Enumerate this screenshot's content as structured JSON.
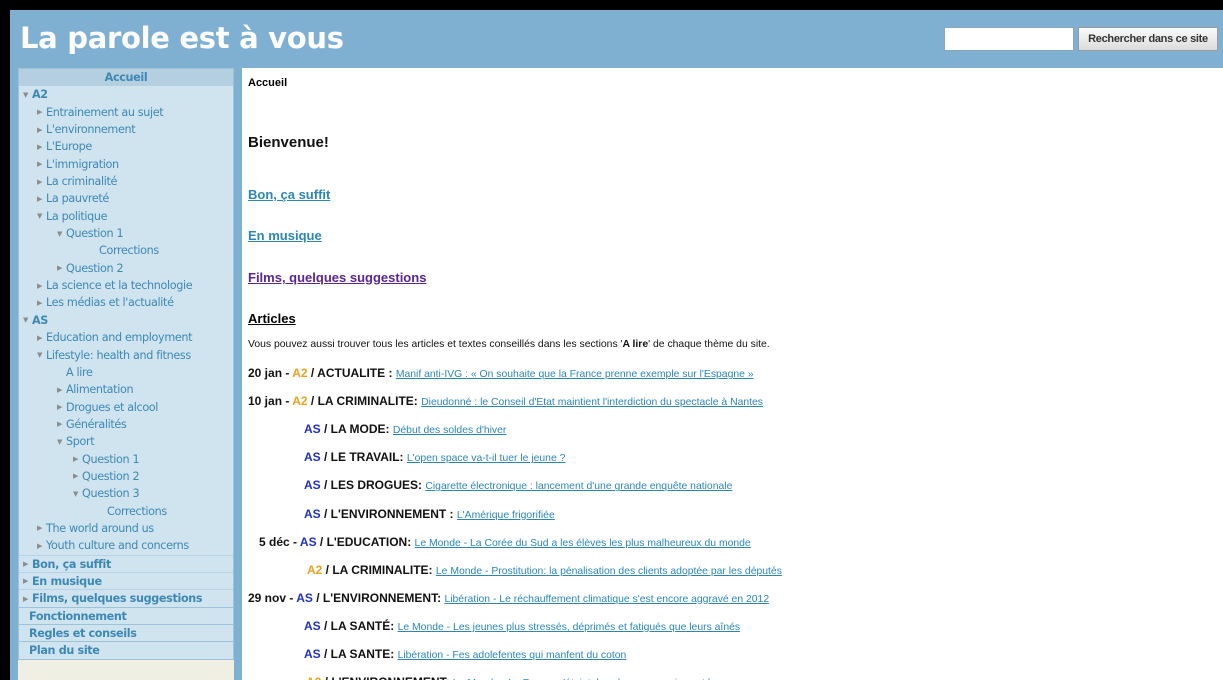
{
  "site": {
    "title": "La parole est à vous"
  },
  "search": {
    "placeholder": "",
    "value": "",
    "button_label": "Rechercher dans ce site"
  },
  "sidebar": {
    "items": [
      {
        "label": "Accueil",
        "level": 0,
        "arrow": "",
        "kind": "active",
        "name": "sidebar-item-accueil"
      },
      {
        "label": "A2",
        "level": 0,
        "arrow": "down",
        "kind": "sec",
        "name": "sidebar-item-a2"
      },
      {
        "label": "Entrainement au sujet",
        "level": 1,
        "arrow": "right",
        "kind": "item",
        "name": "sidebar-item-entrainement"
      },
      {
        "label": "L'environnement",
        "level": 1,
        "arrow": "right",
        "kind": "item",
        "name": "sidebar-item-environnement"
      },
      {
        "label": "L'Europe",
        "level": 1,
        "arrow": "right",
        "kind": "item",
        "name": "sidebar-item-europe"
      },
      {
        "label": "L'immigration",
        "level": 1,
        "arrow": "right",
        "kind": "item",
        "name": "sidebar-item-immigration"
      },
      {
        "label": "La criminalité",
        "level": 1,
        "arrow": "right",
        "kind": "item",
        "name": "sidebar-item-criminalite"
      },
      {
        "label": "La pauvreté",
        "level": 1,
        "arrow": "right",
        "kind": "item",
        "name": "sidebar-item-pauvrete"
      },
      {
        "label": "La politique",
        "level": 1,
        "arrow": "down",
        "kind": "item",
        "name": "sidebar-item-politique"
      },
      {
        "label": "Question 1",
        "level": 2,
        "arrow": "down",
        "kind": "item",
        "name": "sidebar-item-politique-question-1"
      },
      {
        "label": "Corrections",
        "level": 3,
        "arrow": "",
        "kind": "item",
        "name": "sidebar-item-politique-corrections"
      },
      {
        "label": "Question 2",
        "level": 2,
        "arrow": "right",
        "kind": "item",
        "name": "sidebar-item-politique-question-2"
      },
      {
        "label": "La science et la technologie",
        "level": 1,
        "arrow": "right",
        "kind": "item",
        "name": "sidebar-item-science"
      },
      {
        "label": "Les médias et l'actualité",
        "level": 1,
        "arrow": "right",
        "kind": "item",
        "name": "sidebar-item-medias"
      },
      {
        "label": "AS",
        "level": 0,
        "arrow": "down",
        "kind": "sec",
        "name": "sidebar-item-as"
      },
      {
        "label": "Education and employment",
        "level": 1,
        "arrow": "right",
        "kind": "item",
        "name": "sidebar-item-education"
      },
      {
        "label": "Lifestyle: health and fitness",
        "level": 1,
        "arrow": "down",
        "kind": "item",
        "name": "sidebar-item-lifestyle"
      },
      {
        "label": "A lire",
        "level": 2,
        "arrow": "",
        "kind": "item",
        "name": "sidebar-item-a-lire"
      },
      {
        "label": "Alimentation",
        "level": 2,
        "arrow": "right",
        "kind": "item",
        "name": "sidebar-item-alimentation"
      },
      {
        "label": "Drogues et alcool",
        "level": 2,
        "arrow": "right",
        "kind": "item",
        "name": "sidebar-item-drogues"
      },
      {
        "label": "Généralités",
        "level": 2,
        "arrow": "right",
        "kind": "item",
        "name": "sidebar-item-generalites"
      },
      {
        "label": "Sport",
        "level": 2,
        "arrow": "down",
        "kind": "item",
        "name": "sidebar-item-sport"
      },
      {
        "label": "Question 1",
        "level": 3,
        "arrow": "right",
        "kind": "item",
        "name": "sidebar-item-sport-question-1"
      },
      {
        "label": "Question 2",
        "level": 3,
        "arrow": "right",
        "kind": "item",
        "name": "sidebar-item-sport-question-2"
      },
      {
        "label": "Question 3",
        "level": 3,
        "arrow": "down",
        "kind": "item",
        "name": "sidebar-item-sport-question-3"
      },
      {
        "label": "Corrections",
        "level": 4,
        "arrow": "",
        "kind": "item",
        "name": "sidebar-item-sport-corrections"
      },
      {
        "label": "The world around us",
        "level": 1,
        "arrow": "right",
        "kind": "item",
        "name": "sidebar-item-world"
      },
      {
        "label": "Youth culture and concerns",
        "level": 1,
        "arrow": "right",
        "kind": "item",
        "name": "sidebar-item-youth"
      },
      {
        "label": "Bon, ça suffit",
        "level": 0,
        "arrow": "right",
        "kind": "top",
        "name": "sidebar-item-bon-ca-suffit"
      },
      {
        "label": "En musique",
        "level": 0,
        "arrow": "right",
        "kind": "top",
        "name": "sidebar-item-en-musique"
      },
      {
        "label": "Films, quelques suggestions",
        "level": 0,
        "arrow": "right",
        "kind": "top",
        "name": "sidebar-item-films"
      },
      {
        "label": "Fonctionnement",
        "level": 0,
        "arrow": "",
        "kind": "top",
        "name": "sidebar-item-fonctionnement"
      },
      {
        "label": "Regles et conseils",
        "level": 0,
        "arrow": "",
        "kind": "top",
        "name": "sidebar-item-regles"
      },
      {
        "label": "Plan du site",
        "level": 0,
        "arrow": "",
        "kind": "top",
        "name": "sidebar-item-plan-du-site"
      }
    ]
  },
  "main": {
    "breadcrumb": "Accueil",
    "welcome": "Bienvenue!",
    "links": [
      {
        "label": "Bon, ça suffit",
        "visited": false
      },
      {
        "label": "En musique",
        "visited": false
      },
      {
        "label": "Films, quelques suggestions",
        "visited": true
      }
    ],
    "articles_heading": "Articles",
    "intro_prefix": "Vous pouvez aussi trouver tous les articles et textes conseillés dans les sections '",
    "intro_bold": "A lire",
    "intro_suffix": "' de chaque thème du site.",
    "articles": [
      {
        "date": "20 jan - ",
        "level": "A2",
        "topic": " / ACTUALITE : ",
        "title": "Manif anti-IVG : « On souhaite que la France prenne exemple sur l'Espagne »"
      },
      {
        "date": "10 jan - ",
        "level": "A2",
        "topic": " / LA CRIMINALITE: ",
        "title": "Dieudonné : le Conseil d'Etat maintient l'interdiction du spectacle à Nantes"
      },
      {
        "date": "",
        "level": "AS",
        "topic": " / LA MODE: ",
        "title": "Début des soldes d'hiver"
      },
      {
        "date": "",
        "level": "AS",
        "topic": " / LE TRAVAIL: ",
        "title": "L'open space va-t-il tuer le jeune ?"
      },
      {
        "date": "",
        "level": "AS",
        "topic": " / LES DROGUES: ",
        "title": "Cigarette électronique : lancement d'une grande enquête nationale"
      },
      {
        "date": "",
        "level": "AS",
        "topic": " / L'ENVIRONNEMENT : ",
        "title": "L'Amérique frigorifiée"
      },
      {
        "date": "5 déc - ",
        "level": "AS",
        "topic": " / L'EDUCATION: ",
        "title": "Le Monde - La Corée du Sud a les élèves les plus malheureux du monde"
      },
      {
        "date": "",
        "level": "A2",
        "topic": " / LA CRIMINALITE: ",
        "title": "Le Monde - Prostitution: la pénalisation des clients adoptée par les députés"
      },
      {
        "date": "29 nov - ",
        "level": "AS",
        "topic": " / L'ENVIRONNEMENT: ",
        "title": "Libération - Le réchauffement climatique s'est encore aggravé en 2012"
      },
      {
        "date": "",
        "level": "AS",
        "topic": " / LA SANTÉ: ",
        "title": "Le Monde - Les jeunes plus stressés, déprimés et fatigués que leurs aînés"
      },
      {
        "date": "",
        "level": "AS",
        "topic": " / LA SANTE: ",
        "title": "Libération - Fes adolefentes qui manfent du coton"
      },
      {
        "date": "",
        "level": "A2",
        "topic": " / L'ENVIRONNEMENT: ",
        "title": "Le Monde - La France s'éteint, les chauves-souris sont heureuses"
      }
    ]
  },
  "colors": {
    "header_bg": "#7fb0d2",
    "nav_bg": "#cfe4ef",
    "link": "#2b86b8",
    "visited_link": "#5a2590",
    "a2": "#f0a020",
    "as": "#2030c0"
  }
}
